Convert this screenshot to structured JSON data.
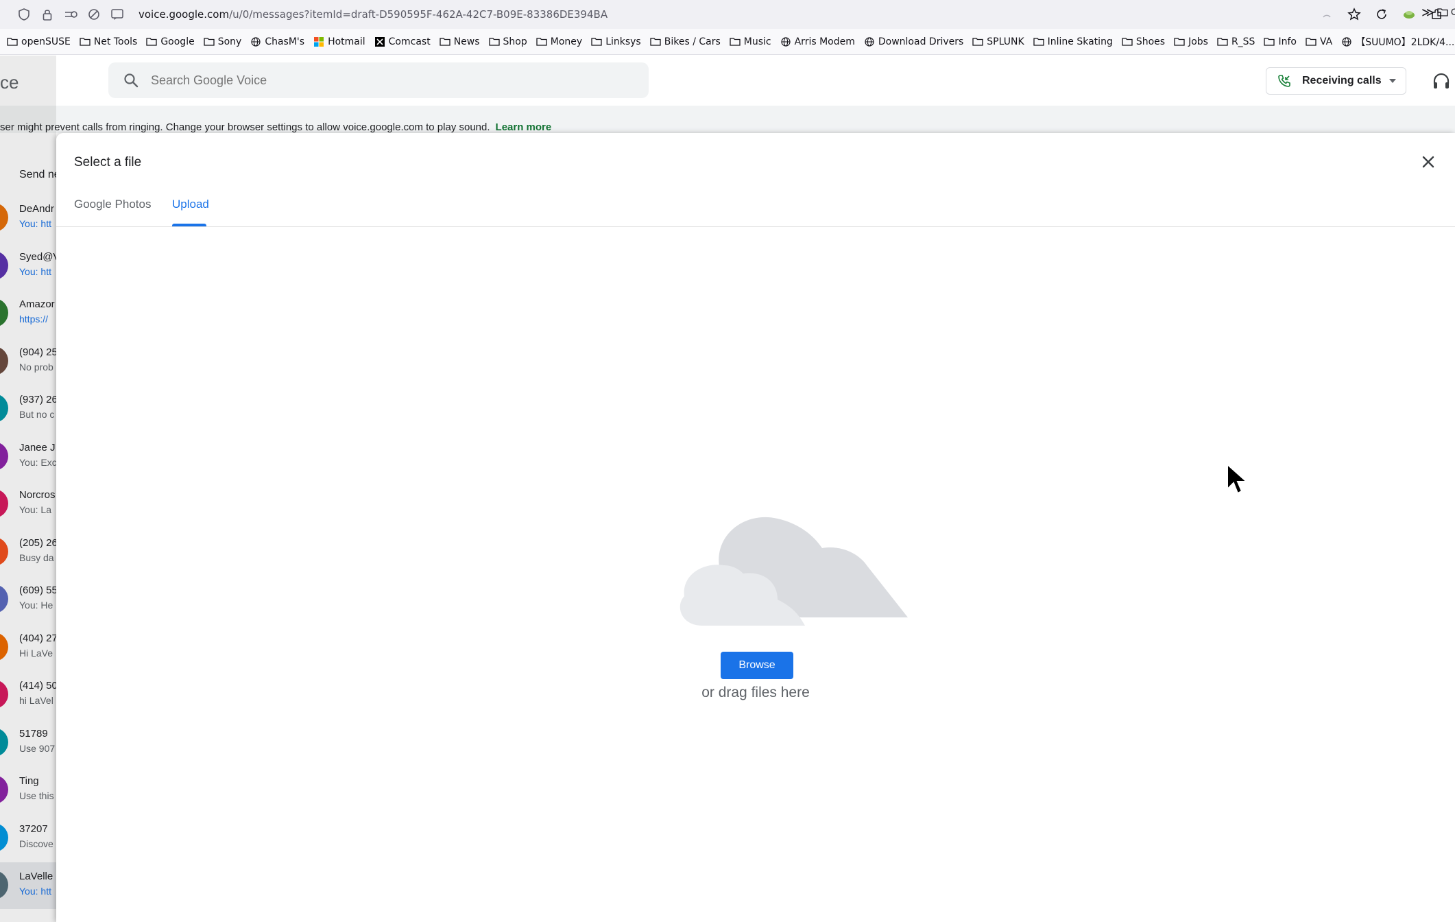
{
  "browser": {
    "url_host": "voice.google.com",
    "url_path": "/u/0/messages?itemId=draft-D590595F-462A-42C7-B09E-83386DE394BA",
    "bookmarks": [
      {
        "label": "openSUSE",
        "icon": "folder-icon"
      },
      {
        "label": "Net Tools",
        "icon": "folder-icon"
      },
      {
        "label": "Google",
        "icon": "folder-icon"
      },
      {
        "label": "Sony",
        "icon": "folder-icon"
      },
      {
        "label": "ChasM's",
        "icon": "globe-icon"
      },
      {
        "label": "Hotmail",
        "icon": "microsoft-icon"
      },
      {
        "label": "Comcast",
        "icon": "x-icon"
      },
      {
        "label": "News",
        "icon": "folder-icon"
      },
      {
        "label": "Shop",
        "icon": "folder-icon"
      },
      {
        "label": "Money",
        "icon": "folder-icon"
      },
      {
        "label": "Linksys",
        "icon": "folder-icon"
      },
      {
        "label": "Bikes / Cars",
        "icon": "folder-icon"
      },
      {
        "label": "Music",
        "icon": "folder-icon"
      },
      {
        "label": "Arris Modem",
        "icon": "globe-icon"
      },
      {
        "label": "Download Drivers",
        "icon": "globe-icon"
      },
      {
        "label": "SPLUNK",
        "icon": "folder-icon"
      },
      {
        "label": "Inline Skating",
        "icon": "folder-icon"
      },
      {
        "label": "Shoes",
        "icon": "folder-icon"
      },
      {
        "label": "Jobs",
        "icon": "folder-icon"
      },
      {
        "label": "R_SS",
        "icon": "folder-icon"
      },
      {
        "label": "Info",
        "icon": "folder-icon"
      },
      {
        "label": "VA",
        "icon": "folder-icon"
      },
      {
        "label": "【SUUMO】2LDK/4...",
        "icon": "globe-icon"
      }
    ],
    "bookmarks_overflow": "≫",
    "bookmarks_tail": "C"
  },
  "app": {
    "title_fragment": "ce",
    "search_placeholder": "Search Google Voice",
    "receiving_calls_label": "Receiving calls"
  },
  "banner": {
    "text": "ser might prevent calls from ringing. Change your browser settings to allow voice.google.com to play sound.",
    "link": "Learn more"
  },
  "conversations": {
    "send_new": "Send ne",
    "items": [
      {
        "name": "DeAndr",
        "snippet": "You: htt",
        "color": "#e8710a"
      },
      {
        "name": "Syed@V",
        "snippet": "You: htt",
        "color": "#5e35b1"
      },
      {
        "name": "Amazor",
        "snippet": "https://",
        "color": "#2e7d32"
      },
      {
        "name": "(904) 25",
        "snippet": "No prob",
        "color": "#6d4c41"
      },
      {
        "name": "(937) 26",
        "snippet": "But no c",
        "color": "#0097a7"
      },
      {
        "name": "Janee J",
        "snippet": "You: Exc",
        "color": "#8e24aa"
      },
      {
        "name": "Norcros",
        "snippet": "You: La",
        "color": "#d81b60"
      },
      {
        "name": "(205) 26",
        "snippet": "Busy da",
        "color": "#f4511e"
      },
      {
        "name": "(609) 55",
        "snippet": "You: He",
        "color": "#5c6bc0"
      },
      {
        "name": "(404) 27",
        "snippet": "Hi LaVe",
        "color": "#ef6c00"
      },
      {
        "name": "(414) 50",
        "snippet": "hi LaVel",
        "color": "#d81b60"
      },
      {
        "name": "51789",
        "snippet": "Use 907",
        "color": "#0097a7"
      },
      {
        "name": "Ting",
        "snippet": "Use this",
        "color": "#8e24aa"
      },
      {
        "name": "37207",
        "snippet": "Discove",
        "color": "#039be5"
      },
      {
        "name": "LaVelle",
        "snippet": "You: htt",
        "color": "#546e7a"
      }
    ]
  },
  "dialog": {
    "title": "Select a file",
    "tabs": [
      {
        "label": "Google Photos"
      },
      {
        "label": "Upload"
      }
    ],
    "browse_label": "Browse",
    "drag_text": "or drag files here"
  },
  "colors": {
    "accent": "#1a73e8",
    "learn_more": "#137333"
  }
}
